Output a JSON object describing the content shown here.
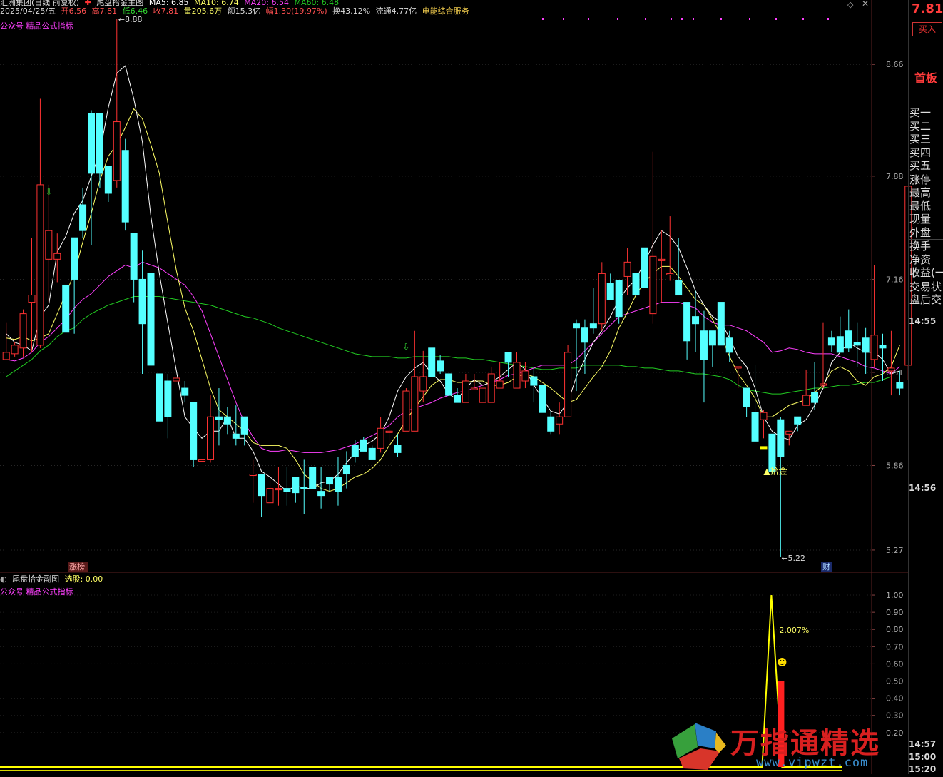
{
  "header": {
    "stock_name": "汇洲集团(日线 前复权)",
    "indicator_name": "尾盘拾金主图",
    "ma5": "MA5: 6.85",
    "ma10": "MA10: 6.74",
    "ma20": "MA20: 6.54",
    "ma60": "MA60: 6.48",
    "date": "2025/04/25/五",
    "open": "开6.56",
    "high": "高7.81",
    "low": "低6.46",
    "close": "收7.81",
    "volume": "量205.6万",
    "amount": "额15.3亿",
    "change": "幅1.30(19.97%)",
    "turnover": "换43.12%",
    "float": "流通4.77亿",
    "sector": "电能综合服务"
  },
  "main_label": "公众号 精品公式指标",
  "sub_header": {
    "title": "尾盘拾金副图",
    "select_label": "选股: 0.00",
    "sub_label": "公众号 精品公式指标"
  },
  "annotations": {
    "high_mark": "8.88",
    "low_mark": "5.22",
    "signal": "▲拾金",
    "zhangbang": "涨榜",
    "cai": "财",
    "pct": "2.007%"
  },
  "right_panel": {
    "price": "7.81",
    "buy_button": "买入",
    "board": "首板",
    "group1": [
      "买一",
      "买二",
      "买三",
      "买四",
      "买五"
    ],
    "group2": [
      "涨停",
      "最高",
      "最低",
      "现量",
      "外盘"
    ],
    "group3": [
      "换手",
      "净资",
      "收益(一"
    ],
    "group4": [
      "交易状",
      "盘后交"
    ],
    "times": [
      "14:55",
      "14:56",
      "14:57",
      "15:00",
      "15:20"
    ]
  },
  "watermark": {
    "text": "万指通精选",
    "url": "www.vipwzt.com"
  },
  "colors": {
    "up": "#ff3232",
    "down": "#54ffff",
    "ma5": "#ffffff",
    "ma10": "#ffff66",
    "ma20": "#ff40ff",
    "ma60": "#22cc22"
  },
  "chart_data": [
    {
      "type": "candlestick",
      "title": "尾盘拾金主图",
      "ylim": [
        5.2,
        8.97
      ],
      "yticks": [
        "8.66",
        "7.88",
        "7.16",
        "6.51",
        "5.86",
        "5.27"
      ],
      "ohlc": [
        [
          6.6,
          6.86,
          6.8,
          6.65
        ],
        [
          6.64,
          6.72,
          6.62,
          6.7
        ],
        [
          6.68,
          6.95,
          6.62,
          6.92
        ],
        [
          7.0,
          7.45,
          6.65,
          7.05
        ],
        [
          6.7,
          8.42,
          6.68,
          7.82
        ],
        [
          7.3,
          7.82,
          7.0,
          7.5
        ],
        [
          7.3,
          7.48,
          7.14,
          7.34
        ],
        [
          7.12,
          6.7,
          6.88,
          6.79
        ],
        [
          7.45,
          6.85,
          6.78,
          7.16
        ],
        [
          7.68,
          7.8,
          7.45,
          7.5
        ],
        [
          8.32,
          8.34,
          7.4,
          7.9
        ],
        [
          8.32,
          8.32,
          7.8,
          7.9
        ],
        [
          7.95,
          7.3,
          7.7,
          7.76
        ],
        [
          7.85,
          8.98,
          7.8,
          8.26
        ],
        [
          8.06,
          8.14,
          7.5,
          7.56
        ],
        [
          7.48,
          7.48,
          7.0,
          7.16
        ],
        [
          7.16,
          7.36,
          6.5,
          6.85
        ],
        [
          7.2,
          7.2,
          6.5,
          6.56
        ],
        [
          6.5,
          6.1,
          6.2,
          6.17
        ],
        [
          6.45,
          6.5,
          6.05,
          6.2
        ],
        [
          6.45,
          6.2,
          6.45,
          6.47
        ],
        [
          6.4,
          6.45,
          6.3,
          6.35
        ],
        [
          6.3,
          6.3,
          5.85,
          5.9
        ],
        [
          5.9,
          5.67,
          5.9,
          5.9
        ],
        [
          5.9,
          6.35,
          5.88,
          6.2
        ],
        [
          6.2,
          6.4,
          6.0,
          6.18
        ],
        [
          6.2,
          6.27,
          6.08,
          6.15
        ],
        [
          6.08,
          6.28,
          6.0,
          6.05
        ],
        [
          6.2,
          6.2,
          6.0,
          6.08
        ],
        [
          5.8,
          5.9,
          5.6,
          5.8
        ],
        [
          5.8,
          5.8,
          5.5,
          5.65
        ],
        [
          5.6,
          5.78,
          5.6,
          5.7
        ],
        [
          5.7,
          5.85,
          5.58,
          5.7
        ],
        [
          5.7,
          5.85,
          5.58,
          5.68
        ],
        [
          5.78,
          5.78,
          5.6,
          5.67
        ],
        [
          5.71,
          5.9,
          5.52,
          5.7
        ],
        [
          5.85,
          5.75,
          5.85,
          5.7
        ],
        [
          5.68,
          5.85,
          5.56,
          5.65
        ],
        [
          5.78,
          5.78,
          5.68,
          5.73
        ],
        [
          5.78,
          5.92,
          5.58,
          5.68
        ],
        [
          5.86,
          5.96,
          5.7,
          5.8
        ],
        [
          6.0,
          6.04,
          5.88,
          5.92
        ],
        [
          6.04,
          6.06,
          5.96,
          5.96
        ],
        [
          5.98,
          6.0,
          5.92,
          5.9
        ],
        [
          5.98,
          6.2,
          5.95,
          6.12
        ],
        [
          6.1,
          6.25,
          6.0,
          6.1
        ],
        [
          6.0,
          6.08,
          5.92,
          5.95
        ],
        [
          6.1,
          6.4,
          6.1,
          6.38
        ],
        [
          6.1,
          6.8,
          6.1,
          6.48
        ],
        [
          6.38,
          6.66,
          6.3,
          6.48
        ],
        [
          6.68,
          6.68,
          6.5,
          6.48
        ],
        [
          6.59,
          6.63,
          6.5,
          6.52
        ],
        [
          6.5,
          6.5,
          6.4,
          6.35
        ],
        [
          6.35,
          6.4,
          6.38,
          6.3
        ],
        [
          6.3,
          6.5,
          6.38,
          6.45
        ],
        [
          6.4,
          6.5,
          6.4,
          6.4
        ],
        [
          6.3,
          6.26,
          6.38,
          6.4
        ],
        [
          6.3,
          6.55,
          6.3,
          6.5
        ],
        [
          6.4,
          6.58,
          6.4,
          6.45
        ],
        [
          6.65,
          6.65,
          6.48,
          6.58
        ],
        [
          6.4,
          6.65,
          6.5,
          6.58
        ],
        [
          6.45,
          6.58,
          6.4,
          6.52
        ],
        [
          6.48,
          6.54,
          6.3,
          6.42
        ],
        [
          6.42,
          6.4,
          6.25,
          6.23
        ],
        [
          6.2,
          6.24,
          6.08,
          6.1
        ],
        [
          6.15,
          6.3,
          6.08,
          6.2
        ],
        [
          6.2,
          6.7,
          6.2,
          6.65
        ],
        [
          6.85,
          6.88,
          6.38,
          6.82
        ],
        [
          6.82,
          6.88,
          6.5,
          6.72
        ],
        [
          6.85,
          7.1,
          6.78,
          6.82
        ],
        [
          6.85,
          7.28,
          6.8,
          7.2
        ],
        [
          7.13,
          7.2,
          7.1,
          7.02
        ],
        [
          7.15,
          7.15,
          6.85,
          6.9
        ],
        [
          7.18,
          7.38,
          7.05,
          7.28
        ],
        [
          7.2,
          7.05,
          7.02,
          7.05
        ],
        [
          7.38,
          7.2,
          7.1,
          7.1
        ],
        [
          6.92,
          8.05,
          6.85,
          7.32
        ],
        [
          7.3,
          7.5,
          7.0,
          7.3
        ],
        [
          7.2,
          7.6,
          7.15,
          7.2
        ],
        [
          7.15,
          7.45,
          7.1,
          7.05
        ],
        [
          7.0,
          6.8,
          6.6,
          6.73
        ],
        [
          6.9,
          7.08,
          6.65,
          6.85
        ],
        [
          6.8,
          6.94,
          6.3,
          6.6
        ],
        [
          6.8,
          6.8,
          6.55,
          6.7
        ],
        [
          7.0,
          6.83,
          6.7,
          6.7
        ],
        [
          6.75,
          6.8,
          6.58,
          6.65
        ],
        [
          6.55,
          6.5,
          6.4,
          6.55
        ],
        [
          6.4,
          6.2,
          6.2,
          6.27
        ],
        [
          6.23,
          6.56,
          6.1,
          6.03
        ],
        [
          6.18,
          6.25,
          6.05,
          6.23
        ],
        [
          6.08,
          5.85,
          5.8,
          5.82
        ],
        [
          6.18,
          6.2,
          5.22,
          5.92
        ],
        [
          6.08,
          6.0,
          6.0,
          6.1
        ],
        [
          6.2,
          6.2,
          6.1,
          6.15
        ],
        [
          6.28,
          6.53,
          6.28,
          6.35
        ],
        [
          6.37,
          6.58,
          6.25,
          6.3
        ],
        [
          6.42,
          6.86,
          6.4,
          6.43
        ],
        [
          6.75,
          6.8,
          6.65,
          6.7
        ],
        [
          6.76,
          6.9,
          6.75,
          6.65
        ],
        [
          6.8,
          6.95,
          6.65,
          6.68
        ],
        [
          6.72,
          6.86,
          6.55,
          6.7
        ],
        [
          6.75,
          6.82,
          6.5,
          6.65
        ],
        [
          6.6,
          7.26,
          6.55,
          6.77
        ],
        [
          6.7,
          6.78,
          6.45,
          6.68
        ],
        [
          6.52,
          6.8,
          6.35,
          6.54
        ],
        [
          6.44,
          6.52,
          6.35,
          6.4
        ],
        [
          6.56,
          7.81,
          6.46,
          7.81
        ]
      ],
      "ma5": [
        6.78,
        6.72,
        6.7,
        6.66,
        6.9,
        6.98,
        7.35,
        7.46,
        7.62,
        7.71,
        7.88,
        8.04,
        8.36,
        8.6,
        8.65,
        8.42,
        8.12,
        7.6,
        7.2,
        6.85,
        6.52,
        6.2,
        6.12,
        6.05,
        6.1,
        6.1,
        6.2,
        6.05,
        6.05,
        5.96,
        5.82,
        5.78,
        5.73,
        5.68,
        5.72,
        5.7,
        5.7,
        5.74,
        5.75,
        5.8,
        5.88,
        5.95,
        6.0,
        6.03,
        6.08,
        6.2,
        6.38,
        6.48,
        6.54,
        6.58,
        6.5,
        6.45,
        6.36,
        6.32,
        6.4,
        6.46,
        6.42,
        6.44,
        6.48,
        6.53,
        6.58,
        6.53,
        6.42,
        6.33,
        6.24,
        6.22,
        6.3,
        6.48,
        6.6,
        6.72,
        6.8,
        6.9,
        7.02,
        7.1,
        7.16,
        7.28,
        7.4,
        7.5,
        7.46,
        7.38,
        7.24,
        7.08,
        6.98,
        6.9,
        6.86,
        6.75,
        6.62,
        6.55,
        6.4,
        6.2,
        6.1,
        6.06,
        6.04,
        6.14,
        6.18,
        6.28,
        6.4,
        6.58,
        6.65,
        6.72,
        6.68,
        6.65,
        6.65,
        6.6,
        6.5,
        6.52
      ],
      "ma10": [
        6.75,
        6.74,
        6.76,
        6.73,
        6.75,
        6.78,
        6.92,
        7.06,
        7.2,
        7.42,
        7.62,
        7.85,
        8.02,
        8.1,
        8.22,
        8.35,
        8.28,
        8.1,
        7.9,
        7.55,
        7.22,
        6.96,
        6.8,
        6.6,
        6.4,
        6.25,
        6.2,
        6.15,
        6.1,
        6.02,
        6.0,
        6.0,
        6.0,
        5.98,
        5.9,
        5.8,
        5.75,
        5.7,
        5.68,
        5.7,
        5.74,
        5.78,
        5.8,
        5.84,
        5.9,
        6.0,
        6.08,
        6.18,
        6.26,
        6.34,
        6.42,
        6.46,
        6.46,
        6.44,
        6.44,
        6.45,
        6.45,
        6.42,
        6.42,
        6.44,
        6.48,
        6.5,
        6.48,
        6.44,
        6.4,
        6.35,
        6.3,
        6.32,
        6.4,
        6.48,
        6.55,
        6.66,
        6.82,
        6.93,
        7.05,
        7.14,
        7.2,
        7.25,
        7.25,
        7.18,
        7.1,
        7.02,
        6.98,
        6.88,
        6.77,
        6.62,
        6.5,
        6.42,
        6.33,
        6.2,
        6.2,
        6.24,
        6.28,
        6.3,
        6.32,
        6.37,
        6.42,
        6.52,
        6.55,
        6.52,
        6.45,
        6.42,
        6.48,
        6.5,
        6.55,
        6.7
      ],
      "ma20": [
        6.6,
        6.59,
        6.61,
        6.65,
        6.72,
        6.76,
        6.82,
        6.88,
        6.96,
        7.02,
        7.06,
        7.12,
        7.18,
        7.22,
        7.26,
        7.24,
        7.28,
        7.26,
        7.24,
        7.2,
        7.16,
        7.12,
        7.04,
        6.94,
        6.78,
        6.62,
        6.46,
        6.3,
        6.16,
        6.06,
        5.98,
        5.96,
        5.96,
        5.97,
        5.96,
        5.95,
        5.95,
        5.95,
        5.96,
        5.97,
        5.99,
        6.01,
        6.04,
        6.07,
        6.1,
        6.14,
        6.2,
        6.24,
        6.26,
        6.28,
        6.3,
        6.33,
        6.35,
        6.37,
        6.38,
        6.4,
        6.42,
        6.44,
        6.46,
        6.49,
        6.5,
        6.52,
        6.54,
        6.56,
        6.56,
        6.56,
        6.56,
        6.6,
        6.66,
        6.72,
        6.78,
        6.84,
        6.9,
        6.92,
        6.94,
        6.96,
        6.98,
        7.0,
        7.0,
        7.0,
        6.98,
        6.96,
        6.9,
        6.86,
        6.84,
        6.84,
        6.82,
        6.8,
        6.76,
        6.72,
        6.65,
        6.66,
        6.68,
        6.67,
        6.65,
        6.64,
        6.64,
        6.64,
        6.62,
        6.6,
        6.58,
        6.55,
        6.54,
        6.52,
        6.5,
        6.55
      ],
      "ma60": [
        6.48,
        6.52,
        6.56,
        6.6,
        6.66,
        6.7,
        6.76,
        6.8,
        6.82,
        6.88,
        6.92,
        6.95,
        6.98,
        7.0,
        7.02,
        7.04,
        7.04,
        7.04,
        7.04,
        7.03,
        7.02,
        7.01,
        7.0,
        6.99,
        6.98,
        6.96,
        6.94,
        6.92,
        6.9,
        6.89,
        6.87,
        6.85,
        6.82,
        6.8,
        6.78,
        6.76,
        6.74,
        6.72,
        6.7,
        6.68,
        6.66,
        6.64,
        6.63,
        6.62,
        6.62,
        6.62,
        6.61,
        6.61,
        6.62,
        6.62,
        6.62,
        6.62,
        6.62,
        6.61,
        6.61,
        6.6,
        6.6,
        6.59,
        6.58,
        6.57,
        6.56,
        6.55,
        6.54,
        6.53,
        6.53,
        6.54,
        6.54,
        6.54,
        6.56,
        6.56,
        6.56,
        6.56,
        6.56,
        6.55,
        6.55,
        6.54,
        6.54,
        6.53,
        6.52,
        6.52,
        6.51,
        6.5,
        6.5,
        6.49,
        6.48,
        6.46,
        6.42,
        6.39,
        6.38,
        6.37,
        6.36,
        6.36,
        6.37,
        6.38,
        6.39,
        6.4,
        6.4,
        6.41,
        6.42,
        6.42,
        6.43,
        6.44,
        6.44,
        6.46,
        6.48
      ]
    },
    {
      "type": "line",
      "title": "尾盘拾金副图",
      "ylim": [
        0,
        1.05
      ],
      "yticks": [
        "1.00",
        "0.90",
        "0.80",
        "0.70",
        "0.60",
        "0.50",
        "0.40",
        "0.30",
        "0.20"
      ],
      "signal_index": 90,
      "peak_value": 1.0,
      "bar_value": 0.5
    }
  ]
}
